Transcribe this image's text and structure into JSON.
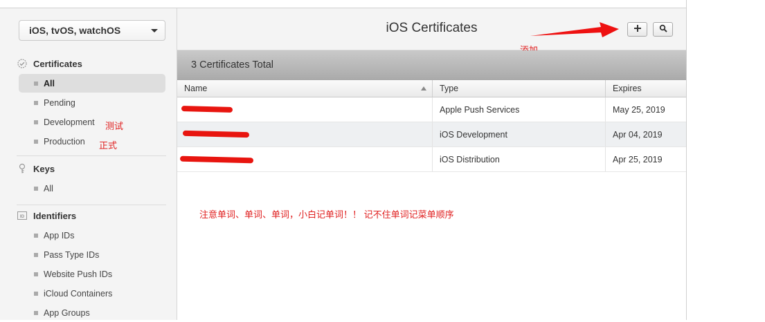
{
  "sidebar": {
    "platform_select": "iOS, tvOS, watchOS",
    "sections": {
      "certificates": {
        "title": "Certificates",
        "items": [
          "All",
          "Pending",
          "Development",
          "Production"
        ]
      },
      "keys": {
        "title": "Keys",
        "items": [
          "All"
        ]
      },
      "identifiers": {
        "title": "Identifiers",
        "items": [
          "App IDs",
          "Pass Type IDs",
          "Website Push IDs",
          "iCloud Containers",
          "App Groups"
        ]
      }
    },
    "notes": {
      "development": "测试",
      "production": "正式"
    }
  },
  "header": {
    "title": "iOS Certificates",
    "add_note": "添加"
  },
  "total": "3 Certificates Total",
  "table": {
    "columns": [
      "Name",
      "Type",
      "Expires"
    ],
    "rows": [
      {
        "type": "Apple Push Services",
        "expires": "May 25, 2019"
      },
      {
        "type": "iOS Development",
        "expires": "Apr 04, 2019"
      },
      {
        "type": "iOS Distribution",
        "expires": "Apr 25, 2019"
      }
    ]
  },
  "annotation": "注意单词、单词、单词，小白记单词！！ 记不住单词记菜单顺序",
  "colors": {
    "annotation_red": "#e02020",
    "sidebar_bg": "#f4f4f4",
    "total_bar": "#b5b5b5",
    "alt_row": "#eef0f2"
  },
  "icons": [
    "certificate-icon",
    "key-icon",
    "id-icon",
    "plus-icon",
    "search-icon",
    "chevron-down-icon",
    "sort-ascending-icon",
    "arrow-annotation-icon"
  ]
}
